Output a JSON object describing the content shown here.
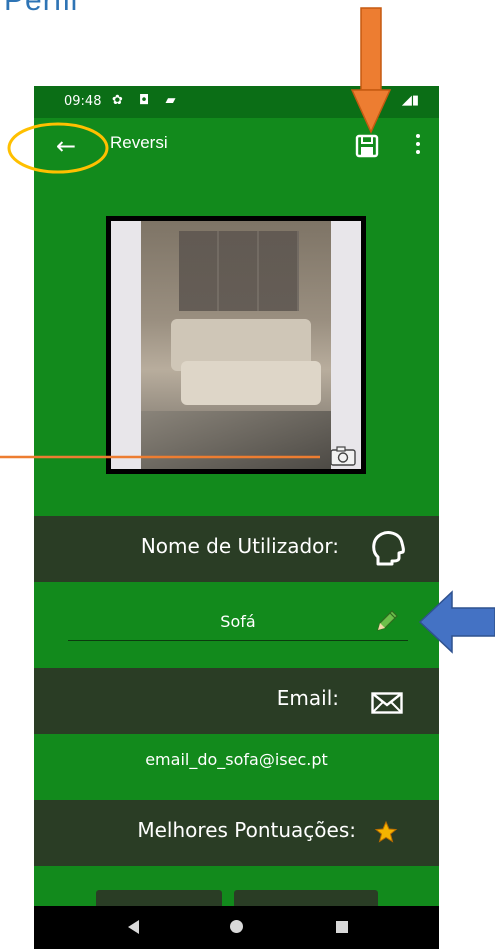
{
  "doc": {
    "title": "Perfil"
  },
  "statusbar": {
    "time": "09:48",
    "icons": "✿ ◘ ▰",
    "right": "◢▮"
  },
  "appbar": {
    "back": "←",
    "title": "Reversi"
  },
  "sections": {
    "username_header": "Nome de Utilizador:",
    "username_value": "Sofá",
    "email_header": "Email:",
    "email_value": "email_do_sofa@isec.pt",
    "scores_header": "Melhores Pontuações:"
  },
  "colors": {
    "primary": "#128a1c",
    "primary_dark": "#0b6e16",
    "section_bg": "#2a3d25",
    "annotation_orange": "#ed7d31",
    "annotation_yellow": "#ffc000",
    "annotation_blue": "#4472c4"
  },
  "icons": {
    "back": "arrow-left-icon",
    "save": "save-icon",
    "menu": "more-vert-icon",
    "camera": "camera-icon",
    "user": "head-profile-icon",
    "edit": "pencil-icon",
    "email": "envelope-icon",
    "score": "star-icon"
  }
}
